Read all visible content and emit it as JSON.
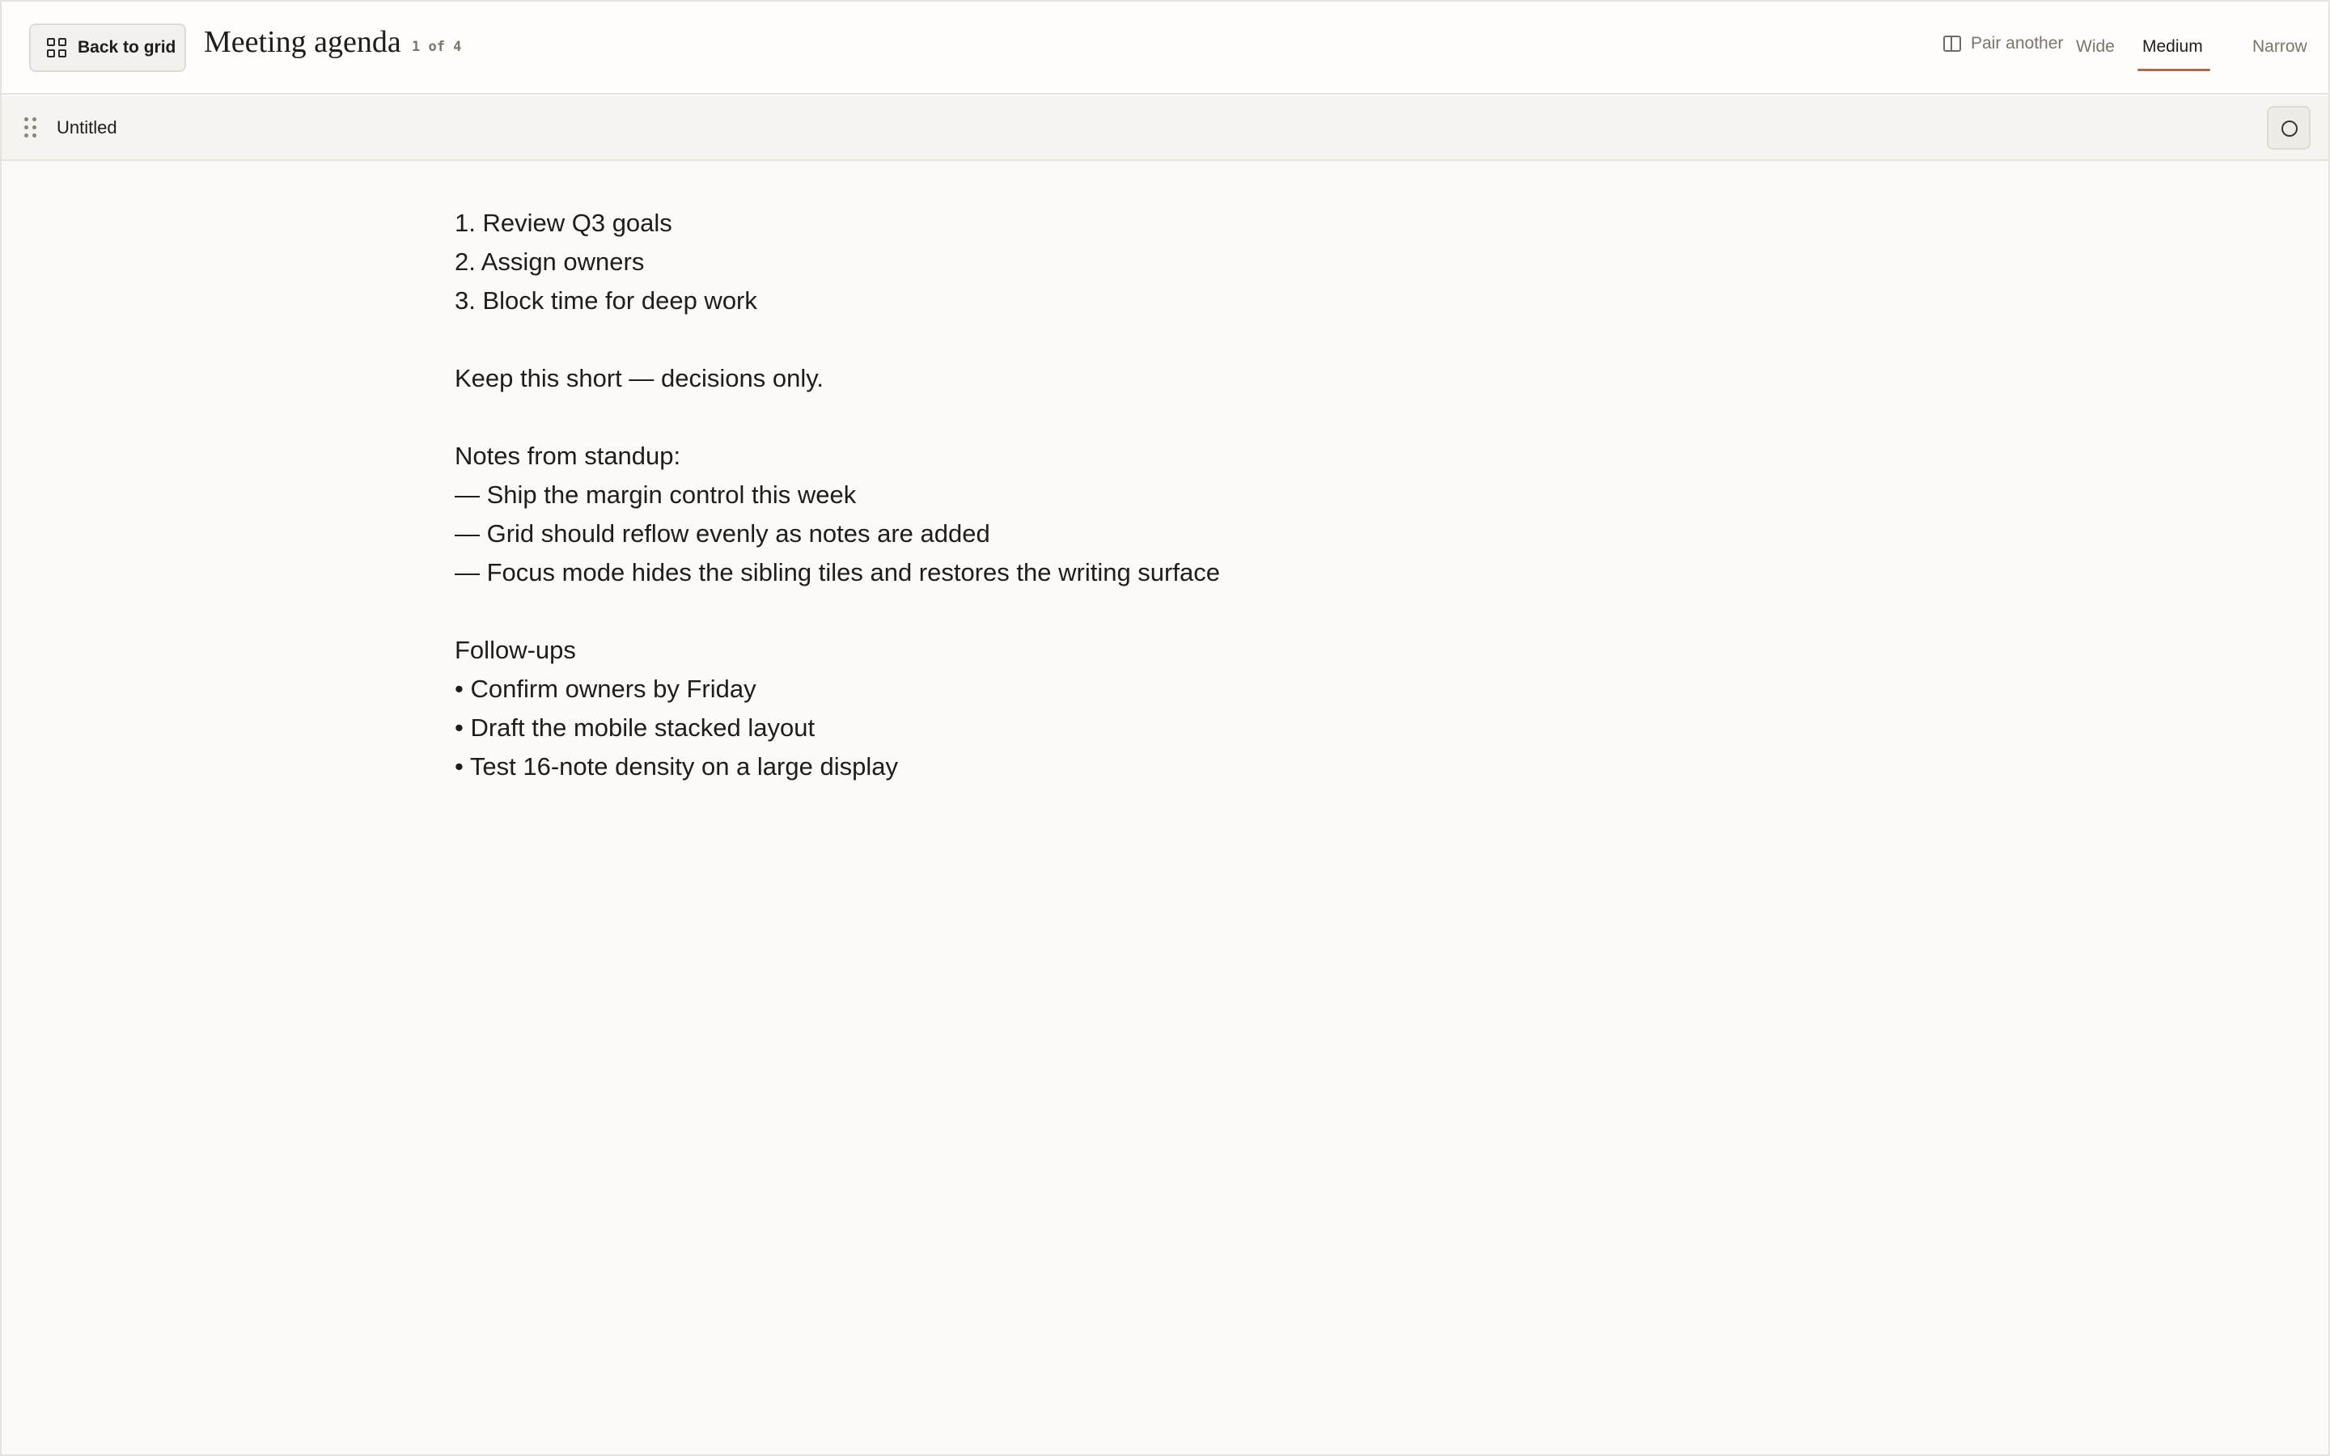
{
  "header": {
    "back_label": "Back to grid",
    "title": "Meeting agenda",
    "counter": "1 of 4",
    "pair_label": "Pair another",
    "width_options": [
      "Wide",
      "Medium",
      "Narrow"
    ],
    "active_width": "Medium",
    "accent_color": "#a86c4f"
  },
  "note": {
    "name": "Untitled",
    "lines": [
      "1. Review Q3 goals",
      "2. Assign owners",
      "3. Block time for deep work",
      "",
      "Keep this short — decisions only.",
      "",
      "Notes from standup:",
      "— Ship the margin control this week",
      "— Grid should reflow evenly as notes are added",
      "— Focus mode hides the sibling tiles and restores the writing surface",
      "",
      "Follow-ups",
      "• Confirm owners by Friday",
      "• Draft the mobile stacked layout",
      "• Test 16-note density on a large display"
    ]
  },
  "icons": {
    "back": "grid-icon",
    "pair": "split-view-icon",
    "drag": "drag-handle-icon",
    "focus": "circle-icon"
  }
}
